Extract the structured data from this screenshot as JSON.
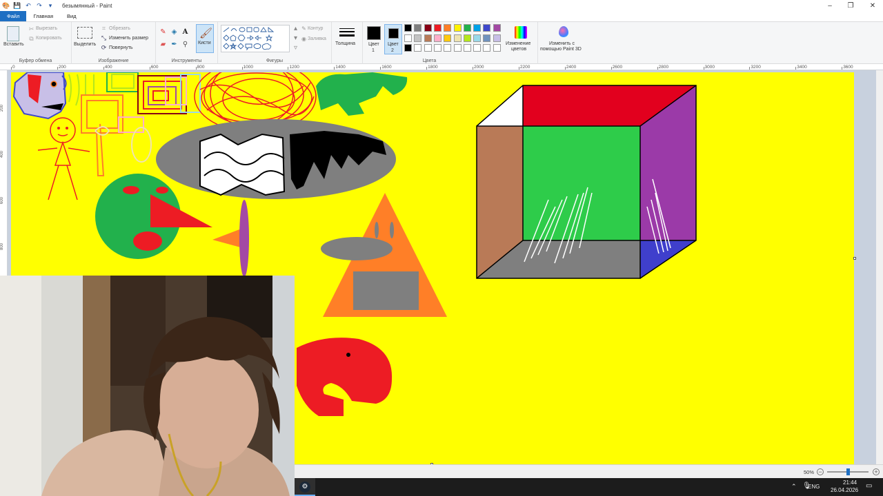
{
  "window": {
    "title": "безымянный - Paint",
    "minimize": "–",
    "maximize": "❐",
    "close": "✕"
  },
  "menu": {
    "tabs": [
      "Файл",
      "Главная",
      "Вид"
    ]
  },
  "ribbon": {
    "clipboard": {
      "group_label": "Буфер обмена",
      "paste": "Вставить",
      "cut": "Вырезать",
      "copy": "Копировать"
    },
    "image": {
      "group_label": "Изображение",
      "select": "Выделить",
      "crop": "Обрезать",
      "resize": "Изменить размер",
      "rotate": "Повернуть"
    },
    "tools": {
      "group_label": "Инструменты",
      "brushes": "Кисти"
    },
    "shapes": {
      "group_label": "Фигуры",
      "outline": "Контур",
      "fill": "Заливка"
    },
    "size": {
      "label": "Толщина"
    },
    "colors": {
      "group_label": "Цвета",
      "color1_line1": "Цвет",
      "color1_line2": "1",
      "color2_line1": "Цвет",
      "color2_line2": "2",
      "edit_colors_line1": "Изменение",
      "edit_colors_line2": "цветов",
      "paint3d_line1": "Изменить с",
      "paint3d_line2": "помощью Paint 3D",
      "color1_value": "#000000",
      "color2_value": "#000000",
      "palette": [
        "#000000",
        "#7f7f7f",
        "#880015",
        "#ed1c24",
        "#ff7f27",
        "#fff200",
        "#22b14c",
        "#00a2e8",
        "#3f48cc",
        "#a349a4",
        "#ffffff",
        "#c3c3c3",
        "#b97a57",
        "#ffaec9",
        "#ffc90e",
        "#efe4b0",
        "#b5e61d",
        "#99d9ea",
        "#7092be",
        "#c8bfe7",
        "#000000",
        "#ffffff",
        "#ffffff",
        "#ffffff",
        "#ffffff",
        "#ffffff",
        "#ffffff",
        "#ffffff",
        "#ffffff",
        "#ffffff"
      ]
    }
  },
  "ruler": {
    "h_ticks": [
      "0",
      "200",
      "400",
      "600",
      "800",
      "1000",
      "1200",
      "1400",
      "1600",
      "1800",
      "2000",
      "2200",
      "2400",
      "2600",
      "2800",
      "3000",
      "3200",
      "3400",
      "3600"
    ],
    "v_ticks": [
      "200",
      "400",
      "600",
      "800"
    ]
  },
  "status": {
    "zoom": "50%",
    "zoom_level": 0.5
  },
  "taskbar": {
    "language": "ENG",
    "time": "21:44",
    "date": "26.04.2026"
  }
}
